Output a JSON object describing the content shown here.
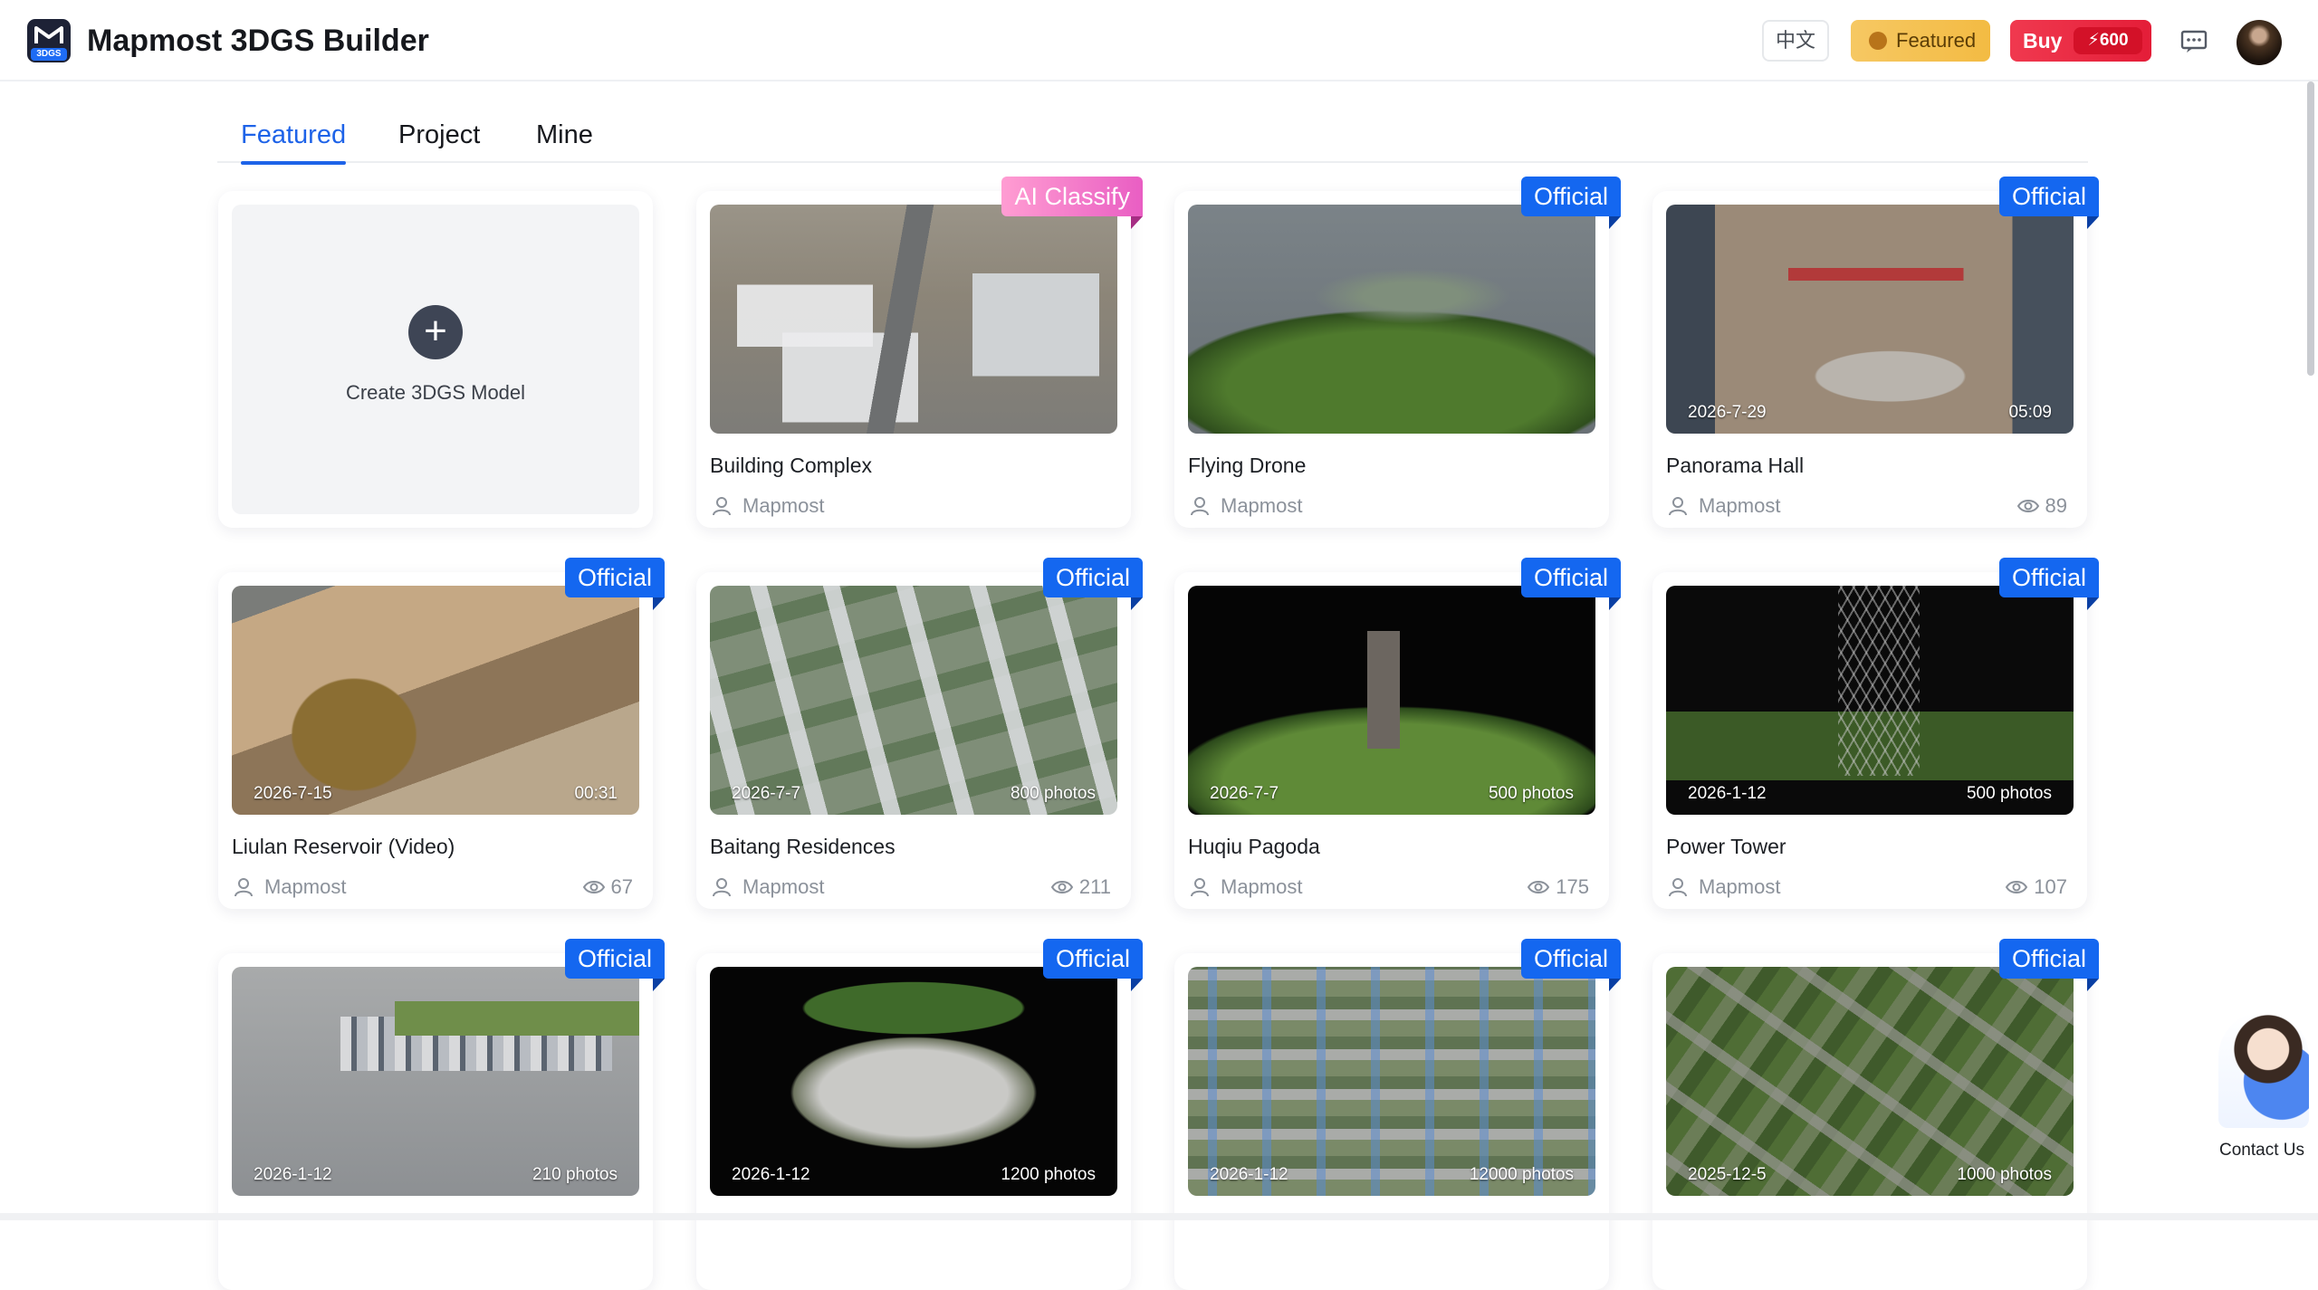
{
  "header": {
    "logo_tag": "3DGS",
    "app_title": "Mapmost 3DGS Builder",
    "lang_label": "中文",
    "featured_label": "Featured",
    "buy_label": "Buy",
    "buy_points": "600"
  },
  "tabs": [
    {
      "label": "Featured",
      "active": true
    },
    {
      "label": "Project",
      "active": false
    },
    {
      "label": "Mine",
      "active": false
    }
  ],
  "create": {
    "label": "Create 3DGS Model"
  },
  "cards": [
    {
      "title": "Building Complex",
      "author": "Mapmost",
      "badge": "AI Classify",
      "date": "",
      "meta": "",
      "views": ""
    },
    {
      "title": "Flying Drone",
      "author": "Mapmost",
      "badge": "Official",
      "date": "",
      "meta": "",
      "views": ""
    },
    {
      "title": "Panorama Hall",
      "author": "Mapmost",
      "badge": "Official",
      "date": "2026-7-29",
      "meta": "05:09",
      "views": "89"
    },
    {
      "title": "Liulan Reservoir (Video)",
      "author": "Mapmost",
      "badge": "Official",
      "date": "2026-7-15",
      "meta": "00:31",
      "views": "67"
    },
    {
      "title": "Baitang Residences",
      "author": "Mapmost",
      "badge": "Official",
      "date": "2026-7-7",
      "meta": "800 photos",
      "views": "211"
    },
    {
      "title": "Huqiu Pagoda",
      "author": "Mapmost",
      "badge": "Official",
      "date": "2026-7-7",
      "meta": "500 photos",
      "views": "175"
    },
    {
      "title": "Power Tower",
      "author": "Mapmost",
      "badge": "Official",
      "date": "2026-1-12",
      "meta": "500 photos",
      "views": "107"
    },
    {
      "title": "",
      "author": "",
      "badge": "Official",
      "date": "2026-1-12",
      "meta": "210 photos",
      "views": ""
    },
    {
      "title": "",
      "author": "",
      "badge": "Official",
      "date": "2026-1-12",
      "meta": "1200 photos",
      "views": ""
    },
    {
      "title": "",
      "author": "",
      "badge": "Official",
      "date": "2026-1-12",
      "meta": "12000 photos",
      "views": ""
    },
    {
      "title": "",
      "author": "",
      "badge": "Official",
      "date": "2025-12-5",
      "meta": "1000 photos",
      "views": ""
    }
  ],
  "contact": {
    "label": "Contact Us"
  },
  "colors": {
    "accent": "#1e63e8",
    "badge_official": "#1467f0",
    "buy": "#e41d38",
    "featured": "#f3bb43"
  }
}
